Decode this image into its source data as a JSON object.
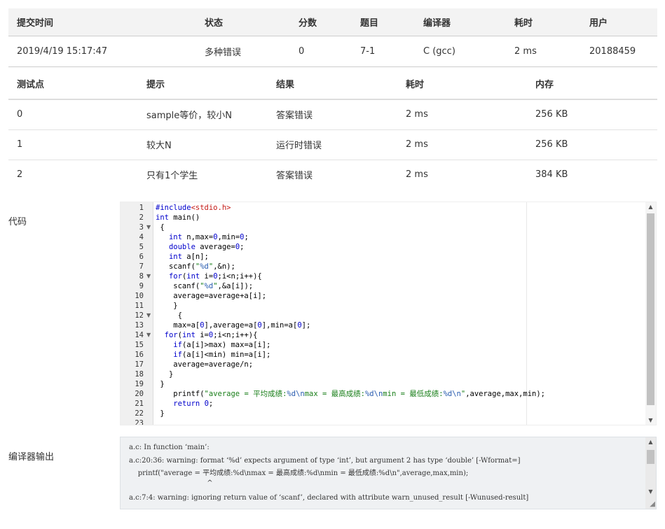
{
  "submission": {
    "headers": [
      "提交时间",
      "状态",
      "分数",
      "题目",
      "编译器",
      "耗时",
      "用户"
    ],
    "row": {
      "time": "2019/4/19 15:17:47",
      "status": "多种错误",
      "score": "0",
      "problem": "7-1",
      "compiler": "C (gcc)",
      "elapsed": "2 ms",
      "user": "20188459"
    }
  },
  "testcases": {
    "headers": [
      "测试点",
      "提示",
      "结果",
      "耗时",
      "内存"
    ],
    "rows": [
      {
        "id": "0",
        "hint": "sample等价，较小N",
        "result": "答案错误",
        "time": "2 ms",
        "memory": "256 KB"
      },
      {
        "id": "1",
        "hint": "较大N",
        "result": "运行时错误",
        "time": "2 ms",
        "memory": "256 KB"
      },
      {
        "id": "2",
        "hint": "只有1个学生",
        "result": "答案错误",
        "time": "2 ms",
        "memory": "384 KB"
      }
    ]
  },
  "labels": {
    "code": "代码",
    "compiler_output": "编译器输出"
  },
  "code_lines": [
    "#include<stdio.h>",
    "int main()",
    " {",
    "   int n,max=0,min=0;",
    "   double average=0;",
    "   int a[n];",
    "   scanf(\"%d\",&n);",
    "   for(int i=0;i<n;i++){",
    "    scanf(\"%d\",&a[i]);",
    "    average=average+a[i];",
    "    }",
    "     {",
    "    max=a[0],average=a[0],min=a[0];",
    "  for(int i=0;i<n;i++){",
    "    if(a[i]>max) max=a[i];",
    "    if(a[i]<min) min=a[i];",
    "    average=average/n;",
    "   }",
    " }",
    "    printf(\"average = 平均成绩:%d\\nmax = 最高成绩:%d\\nmin = 最低成绩:%d\\n\",average,max,min);",
    "    return 0;",
    " }",
    ""
  ],
  "compiler_output_lines": [
    "a.c: In function ‘main’:",
    "a.c:20:36: warning: format ‘%d’ expects argument of type ‘int’, but argument 2 has type ‘double’ [-Wformat=]",
    "    printf(\"average = 平均成绩:%d\\nmax = 最高成绩:%d\\nmin = 最低成绩:%d\\n\",average,max,min);",
    "                                   ^",
    "a.c:7:4: warning: ignoring return value of ‘scanf’, declared with attribute warn_unused_result [-Wunused-result]"
  ],
  "colors": {
    "status_green": "#4cae4c",
    "link_blue": "#2a75bd"
  }
}
